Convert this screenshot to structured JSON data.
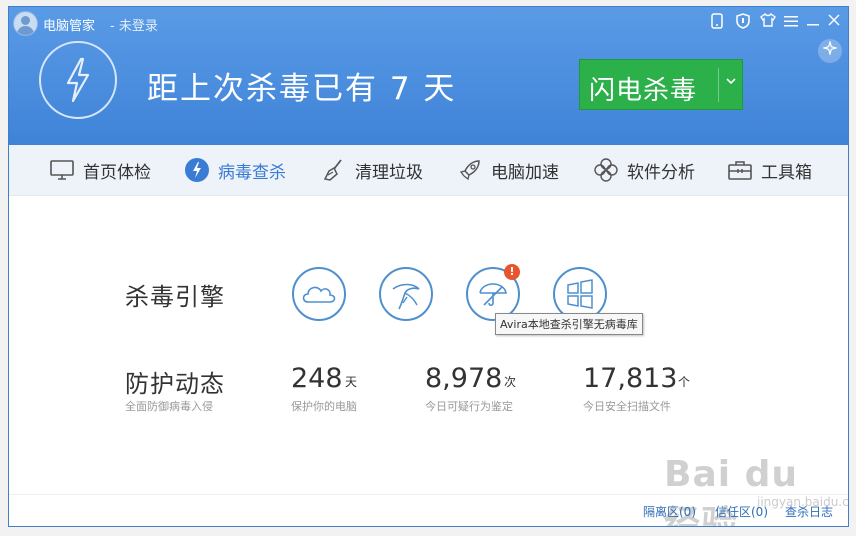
{
  "window": {
    "app_title": "电脑管家",
    "login_status": "- 未登录",
    "title_icons": [
      "phone-icon",
      "shield-icon",
      "shirt-icon",
      "menu-icon",
      "minimize-icon",
      "close-icon"
    ]
  },
  "hero": {
    "headline": "距上次杀毒已有 7 天",
    "scan_button": "闪电杀毒",
    "magic_icon": "sparkle-icon"
  },
  "nav": {
    "items": [
      {
        "label": "首页体检",
        "icon": "monitor-icon"
      },
      {
        "label": "病毒查杀",
        "icon": "lightning-icon",
        "active": true
      },
      {
        "label": "清理垃圾",
        "icon": "broom-icon"
      },
      {
        "label": "电脑加速",
        "icon": "rocket-icon"
      },
      {
        "label": "软件分析",
        "icon": "flower-icon"
      },
      {
        "label": "工具箱",
        "icon": "toolbox-icon"
      }
    ]
  },
  "engines": {
    "title": "杀毒引擎",
    "icons": [
      "cloud-engine-icon",
      "eagle-engine-icon",
      "umbrella-engine-icon",
      "windows-engine-icon"
    ],
    "warning_badge": "!",
    "tooltip": "Avira本地查杀引擎无病毒库"
  },
  "protection": {
    "title": "防护动态",
    "subtitle": "全面防御病毒入侵",
    "stats": [
      {
        "value": "248",
        "unit": "天",
        "label": "保护你的电脑"
      },
      {
        "value": "8,978",
        "unit": "次",
        "label": "今日可疑行为鉴定"
      },
      {
        "value": "17,813",
        "unit": "个",
        "label": "今日安全扫描文件"
      }
    ]
  },
  "footer": {
    "links": [
      "隔离区(0)",
      "信任区(0)",
      "查杀日志"
    ]
  },
  "watermark": {
    "text": "Bai du 经验",
    "sub": "jingyan.baidu.com"
  },
  "colors": {
    "header_blue": "#4a8de0",
    "scan_green": "#2bb04a",
    "accent_blue": "#3a7bd5",
    "warning_orange": "#e8542b"
  }
}
